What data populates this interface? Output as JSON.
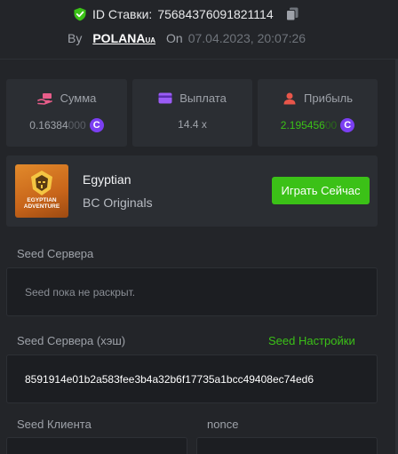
{
  "header": {
    "bet_id_label": "ID Ставки:",
    "bet_id_value": "75684376091821114",
    "by_label": "By",
    "username": "POLANA",
    "username_suffix": "UA",
    "on_label": "On",
    "date": "07.04.2023, 20:07:26"
  },
  "stats": {
    "amount": {
      "label": "Сумма",
      "value_strong": "0.16384",
      "value_faint": "000",
      "icon": "money-hand-icon",
      "coin": "C"
    },
    "payout": {
      "label": "Выплата",
      "value": "14.4 x",
      "icon": "card-icon"
    },
    "profit": {
      "label": "Прибыль",
      "value_strong": "2.195456",
      "value_faint": "00",
      "icon": "user-profit-icon",
      "coin": "C"
    }
  },
  "game": {
    "thumbnail_title_line1": "EGYPTIAN",
    "thumbnail_title_line2": "ADVENTURE",
    "name": "Egyptian",
    "provider": "BC Originals",
    "play_label": "Играть Сейчас"
  },
  "server_seed": {
    "label": "Seed Сервера",
    "placeholder_text": "Seed пока не раскрыт."
  },
  "server_seed_hash": {
    "label": "Seed Сервера (хэш)",
    "settings_label": "Seed Настройки",
    "value": "8591914e01b2a583fee3b4a32b6f17735a1bcc49408ec74ed6"
  },
  "client_seed": {
    "label": "Seed Клиента"
  },
  "nonce": {
    "label": "nonce"
  },
  "colors": {
    "background": "#232529",
    "card": "#2b2e33",
    "input": "#1c1e22",
    "accent_green": "#3bc117",
    "coin_purple": "#7b3ff2"
  }
}
